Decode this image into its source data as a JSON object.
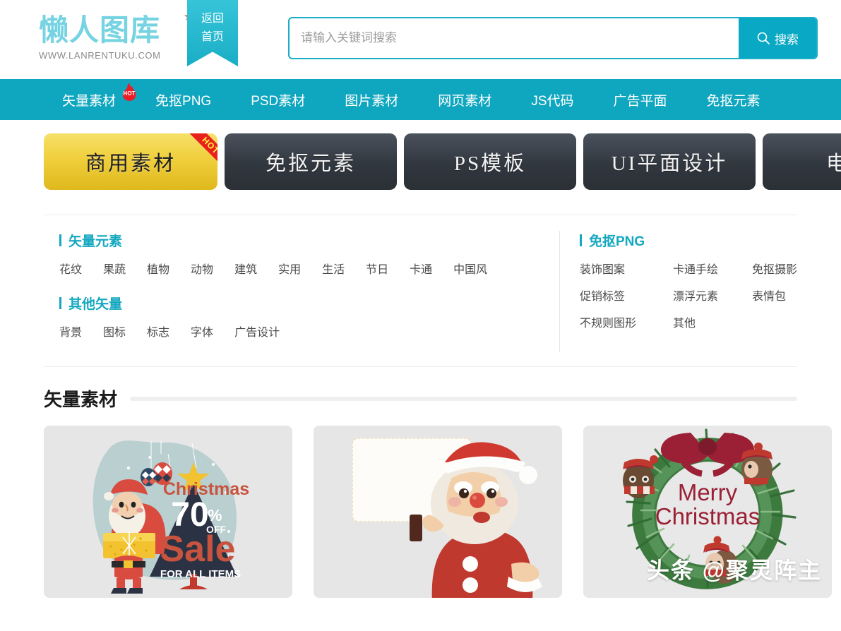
{
  "header": {
    "logo_text": "懒人图库",
    "logo_url": "WWW.LANRENTUKU.COM",
    "star_icon": "star-icon",
    "ribbon": {
      "line1": "返回",
      "line2": "首页"
    },
    "search": {
      "placeholder": "请输入关键词搜索",
      "value": "",
      "button_label": "搜索",
      "button_icon": "search-icon",
      "accent_color": "#09a8c4"
    }
  },
  "nav": {
    "background_color": "#0fa6bf",
    "items": [
      {
        "label": "矢量素材",
        "badge": "HOT"
      },
      {
        "label": "免抠PNG",
        "badge": ""
      },
      {
        "label": "PSD素材",
        "badge": ""
      },
      {
        "label": "图片素材",
        "badge": ""
      },
      {
        "label": "网页素材",
        "badge": ""
      },
      {
        "label": "JS代码",
        "badge": ""
      },
      {
        "label": "广告平面",
        "badge": ""
      },
      {
        "label": "免抠元素",
        "badge": ""
      }
    ]
  },
  "tabs": [
    {
      "label": "商用素材",
      "active": true,
      "corner_badge": "HOT"
    },
    {
      "label": "免抠元素",
      "active": false,
      "corner_badge": ""
    },
    {
      "label": "PS模板",
      "active": false,
      "corner_badge": ""
    },
    {
      "label": "UI平面设计",
      "active": false,
      "corner_badge": ""
    },
    {
      "label": "电商",
      "active": false,
      "corner_badge": ""
    }
  ],
  "categories": {
    "accent_color": "#14a8c0",
    "left": [
      {
        "title": "矢量元素",
        "links": [
          "花纹",
          "果蔬",
          "植物",
          "动物",
          "建筑",
          "实用",
          "生活",
          "节日",
          "卡通",
          "中国风"
        ]
      },
      {
        "title": "其他矢量",
        "links": [
          "背景",
          "图标",
          "标志",
          "字体",
          "广告设计"
        ]
      }
    ],
    "right": [
      {
        "title": "免抠PNG",
        "links": [
          "装饰图案",
          "卡通手绘",
          "免抠摄影",
          "促销标签",
          "漂浮元素",
          "表情包",
          "不规则图形",
          "其他"
        ]
      }
    ]
  },
  "section": {
    "title": "矢量素材"
  },
  "cards": [
    {
      "name": "christmas-sale-card",
      "alt": "圣诞老人促销海报",
      "texts": {
        "t1": "Christmas",
        "t2": "70",
        "t3": "%",
        "t4": "OFF",
        "t5": "Sale",
        "t6": "FOR ALL ITEMS"
      }
    },
    {
      "name": "santa-signboard-card",
      "alt": "圣诞老人举牌",
      "texts": {}
    },
    {
      "name": "christmas-wreath-card",
      "alt": "圣诞花环",
      "texts": {
        "t1": "Merry",
        "t2": "Christmas"
      }
    }
  ],
  "watermark": {
    "text": "头条 @聚灵阵主"
  }
}
